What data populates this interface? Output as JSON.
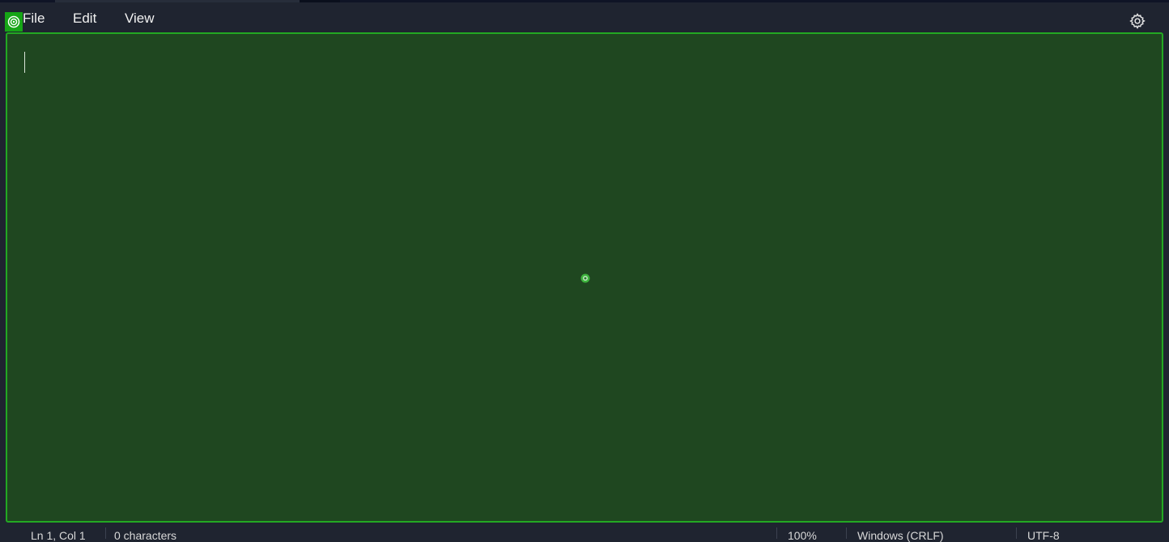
{
  "menubar": {
    "items": [
      {
        "label": "File"
      },
      {
        "label": "Edit"
      },
      {
        "label": "View"
      }
    ],
    "settings_icon": "gear-icon"
  },
  "editor": {
    "content": ""
  },
  "statusbar": {
    "position": "Ln 1, Col 1",
    "characters": "0 characters",
    "zoom": "100%",
    "line_ending": "Windows (CRLF)",
    "encoding": "UTF-8"
  },
  "colors": {
    "background": "#1f2430",
    "editor_fill": "#1f4720",
    "highlight_border": "#23a823"
  }
}
